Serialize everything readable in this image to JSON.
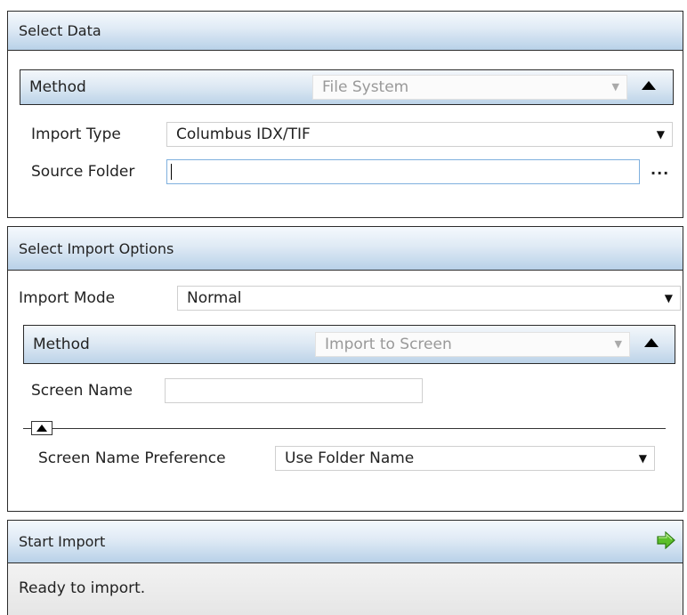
{
  "select_data": {
    "title": "Select Data",
    "method": {
      "label": "Method",
      "value": "File System"
    },
    "import_type": {
      "label": "Import Type",
      "value": "Columbus IDX/TIF"
    },
    "source_folder": {
      "label": "Source Folder",
      "value": "",
      "browse_label": "..."
    }
  },
  "import_options": {
    "title": "Select Import Options",
    "import_mode": {
      "label": "Import Mode",
      "value": "Normal"
    },
    "method": {
      "label": "Method",
      "value": "Import to Screen"
    },
    "screen_name": {
      "label": "Screen Name",
      "value": ""
    },
    "screen_name_pref": {
      "label": "Screen Name Preference",
      "value": "Use Folder Name"
    }
  },
  "start_import": {
    "title": "Start Import",
    "status": "Ready to import.",
    "icon": "green-arrow-right-icon",
    "icon_color": "#4caf2a"
  },
  "colors": {
    "header_top": "#f5f9fd",
    "header_bottom": "#b8d1e8",
    "focus_border": "#7fb0de"
  }
}
